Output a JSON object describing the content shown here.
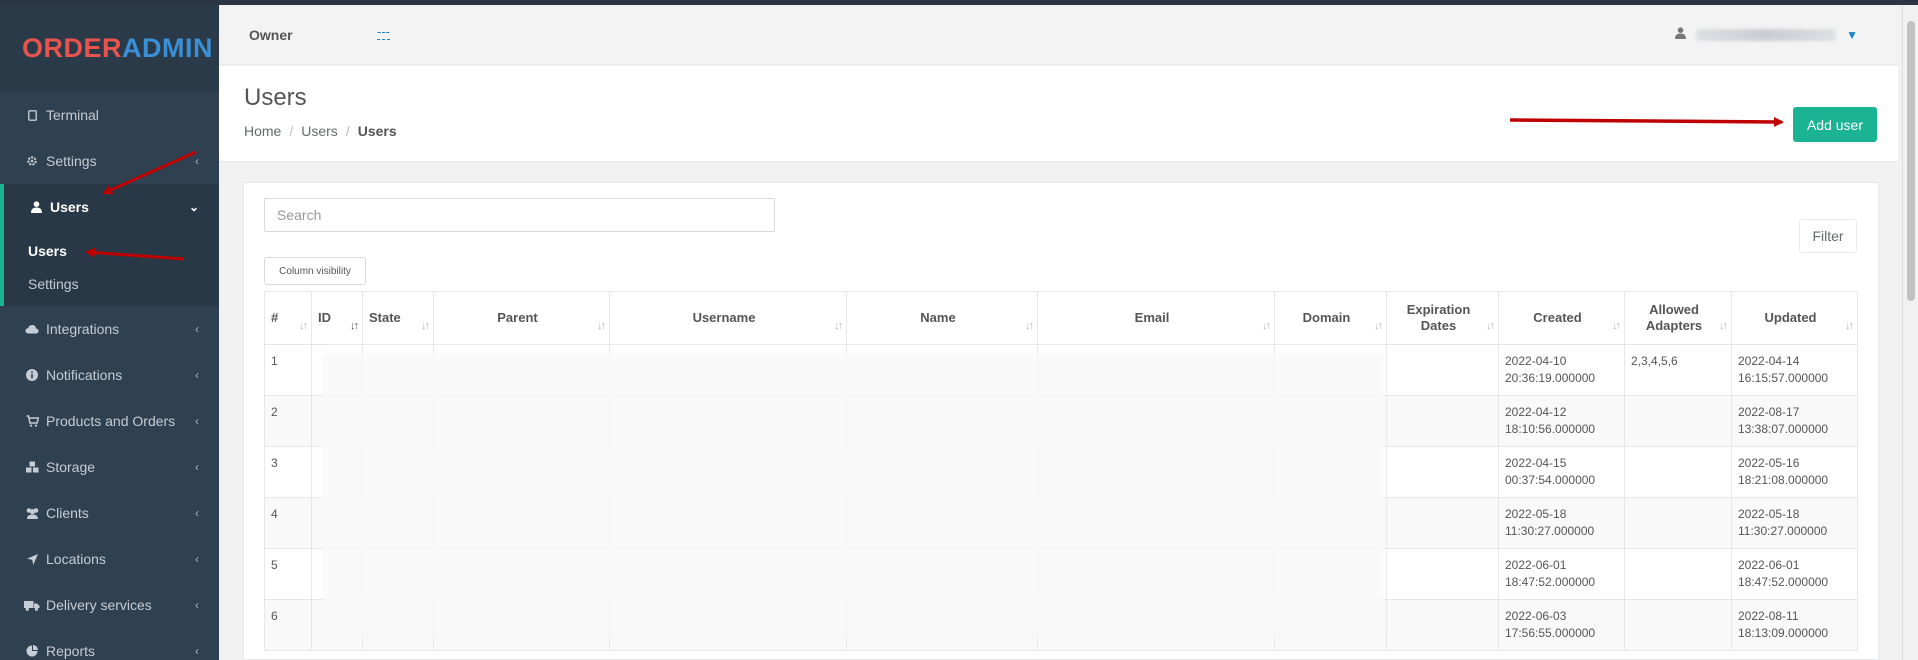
{
  "brand": {
    "part1": "ORDER",
    "part2": "ADMIN"
  },
  "sidebar": {
    "items": [
      {
        "label": "Terminal",
        "icon": "tablet-icon"
      },
      {
        "label": "Settings",
        "icon": "gear-icon"
      },
      {
        "label": "Users",
        "icon": "user-icon"
      },
      {
        "label": "Integrations",
        "icon": "cloud-icon"
      },
      {
        "label": "Notifications",
        "icon": "info-icon"
      },
      {
        "label": "Products and Orders",
        "icon": "cart-icon"
      },
      {
        "label": "Storage",
        "icon": "cubes-icon"
      },
      {
        "label": "Clients",
        "icon": "users-icon"
      },
      {
        "label": "Locations",
        "icon": "location-arrow-icon"
      },
      {
        "label": "Delivery services",
        "icon": "truck-icon"
      },
      {
        "label": "Reports",
        "icon": "pie-chart-icon"
      }
    ],
    "submenu": [
      {
        "label": "Users"
      },
      {
        "label": "Settings"
      }
    ]
  },
  "header": {
    "owner_label": "Owner",
    "owner_value": "---"
  },
  "page": {
    "title": "Users",
    "breadcrumb": [
      "Home",
      "Users",
      "Users"
    ],
    "add_button": "Add user"
  },
  "content": {
    "search_placeholder": "Search",
    "filter_button": "Filter",
    "column_visibility_button": "Column visibility",
    "table": {
      "headers": [
        "#",
        "ID",
        "State",
        "Parent",
        "Username",
        "Name",
        "Email",
        "Domain",
        "Expiration Dates",
        "Created",
        "Allowed Adapters",
        "Updated"
      ],
      "rows": [
        {
          "num": "1",
          "created": "2022-04-10 20:36:19.000000",
          "adapters": "2,3,4,5,6",
          "updated": "2022-04-14 16:15:57.000000"
        },
        {
          "num": "2",
          "created": "2022-04-12 18:10:56.000000",
          "adapters": "",
          "updated": "2022-08-17 13:38:07.000000"
        },
        {
          "num": "3",
          "created": "2022-04-15 00:37:54.000000",
          "adapters": "",
          "updated": "2022-05-16 18:21:08.000000"
        },
        {
          "num": "4",
          "created": "2022-05-18 11:30:27.000000",
          "adapters": "",
          "updated": "2022-05-18 11:30:27.000000"
        },
        {
          "num": "5",
          "created": "2022-06-01 18:47:52.000000",
          "adapters": "",
          "updated": "2022-06-01 18:47:52.000000"
        },
        {
          "num": "6",
          "created": "2022-06-03 17:56:55.000000",
          "adapters": "",
          "updated": "2022-08-11 18:13:09.000000"
        }
      ]
    }
  },
  "colors": {
    "sidebar": "#2f4050",
    "accent": "#1ab394",
    "link": "#1c84c6",
    "arrow": "#c00000"
  }
}
